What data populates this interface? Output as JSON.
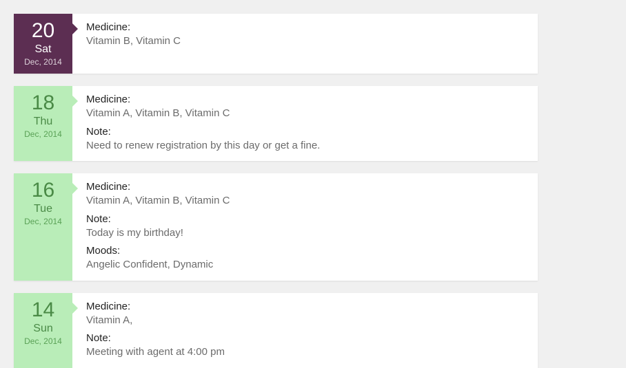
{
  "labels": {
    "medicine": "Medicine:",
    "note": "Note:",
    "moods": "Moods:"
  },
  "entries": [
    {
      "day": "20",
      "dow": "Sat",
      "month": "Dec, 2014",
      "variant": "purple",
      "medicine": "Vitamin B, Vitamin C"
    },
    {
      "day": "18",
      "dow": "Thu",
      "month": "Dec, 2014",
      "variant": "green",
      "medicine": "Vitamin A, Vitamin B, Vitamin C",
      "note": "Need to renew registration by this day or get a fine."
    },
    {
      "day": "16",
      "dow": "Tue",
      "month": "Dec, 2014",
      "variant": "green",
      "medicine": "Vitamin A, Vitamin B, Vitamin C",
      "note": "Today is my birthday!",
      "moods": "Angelic Confident, Dynamic"
    },
    {
      "day": "14",
      "dow": "Sun",
      "month": "Dec, 2014",
      "variant": "green",
      "medicine": "Vitamin A,",
      "note": "Meeting with agent at 4:00 pm"
    }
  ]
}
